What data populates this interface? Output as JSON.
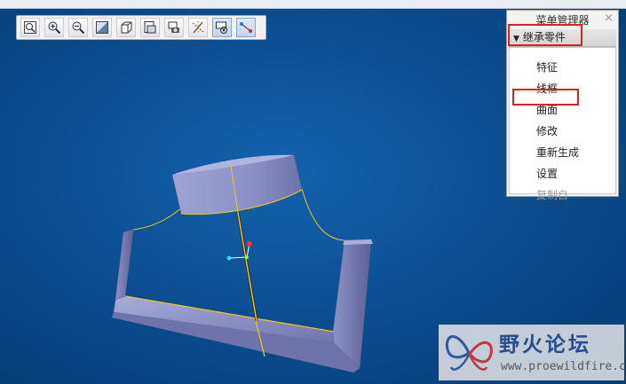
{
  "toolbar": {
    "buttons": [
      {
        "icon": "zoom-fit-icon"
      },
      {
        "icon": "zoom-in-icon"
      },
      {
        "icon": "zoom-out-icon"
      },
      {
        "icon": "refit-icon"
      },
      {
        "icon": "display-style-icon"
      },
      {
        "icon": "saved-views-icon"
      },
      {
        "icon": "view-manager-icon"
      },
      {
        "icon": "datum-display-icon"
      },
      {
        "icon": "spin-center-icon"
      },
      {
        "icon": "annotation-display-icon"
      }
    ]
  },
  "menu_manager": {
    "title": "菜单管理器",
    "close": "×",
    "header": "继承零件",
    "items": [
      {
        "label": "特征",
        "enabled": true
      },
      {
        "label": "线框",
        "enabled": true
      },
      {
        "label": "曲面",
        "enabled": true,
        "highlighted": true
      },
      {
        "label": "修改",
        "enabled": true
      },
      {
        "label": "重新生成",
        "enabled": true
      },
      {
        "label": "设置",
        "enabled": true
      },
      {
        "label": "复制自",
        "enabled": false
      }
    ]
  },
  "watermark": {
    "text_cn": "野火论坛",
    "url": "www.proewildfire.cn"
  },
  "colors": {
    "background": "#0c4f92",
    "highlight_box": "#e02020",
    "model_face": "#8c92c8",
    "edge": "#f3c21c"
  }
}
